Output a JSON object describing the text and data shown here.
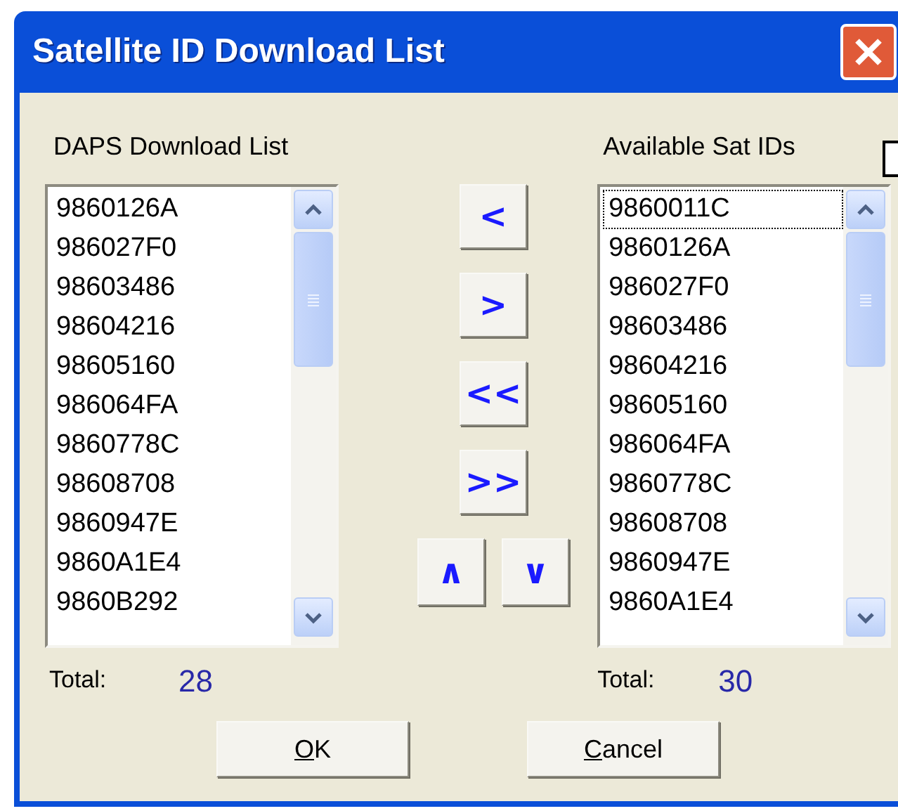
{
  "window": {
    "title": "Satellite ID Download List"
  },
  "daps_list": {
    "label": "DAPS Download List",
    "items": [
      {
        "text": "9860126A",
        "focused": false
      },
      {
        "text": "986027F0",
        "focused": false
      },
      {
        "text": "98603486",
        "focused": false
      },
      {
        "text": "98604216",
        "focused": false
      },
      {
        "text": "98605160",
        "focused": false
      },
      {
        "text": "986064FA",
        "focused": false
      },
      {
        "text": "9860778C",
        "focused": false
      },
      {
        "text": "98608708",
        "focused": false
      },
      {
        "text": "9860947E",
        "focused": false
      },
      {
        "text": "9860A1E4",
        "focused": false
      },
      {
        "text": "9860B292",
        "focused": false
      }
    ],
    "total_label": "Total:",
    "total": "28"
  },
  "move_buttons": [
    "<",
    ">",
    "<<",
    ">>"
  ],
  "order_buttons": [
    "∧",
    "∨"
  ],
  "available_list": {
    "label": "Available Sat IDs",
    "items": [
      {
        "text": "9860011C",
        "focused": true
      },
      {
        "text": "9860126A",
        "focused": false
      },
      {
        "text": "986027F0",
        "focused": false
      },
      {
        "text": "98603486",
        "focused": false
      },
      {
        "text": "98604216",
        "focused": false
      },
      {
        "text": "98605160",
        "focused": false
      },
      {
        "text": "986064FA",
        "focused": false
      },
      {
        "text": "9860778C",
        "focused": false
      },
      {
        "text": "98608708",
        "focused": false
      },
      {
        "text": "9860947E",
        "focused": false
      },
      {
        "text": "9860A1E4",
        "focused": false
      }
    ],
    "total_label": "Total:",
    "total": "30"
  },
  "buttons": [
    "OK",
    "Cancel"
  ]
}
